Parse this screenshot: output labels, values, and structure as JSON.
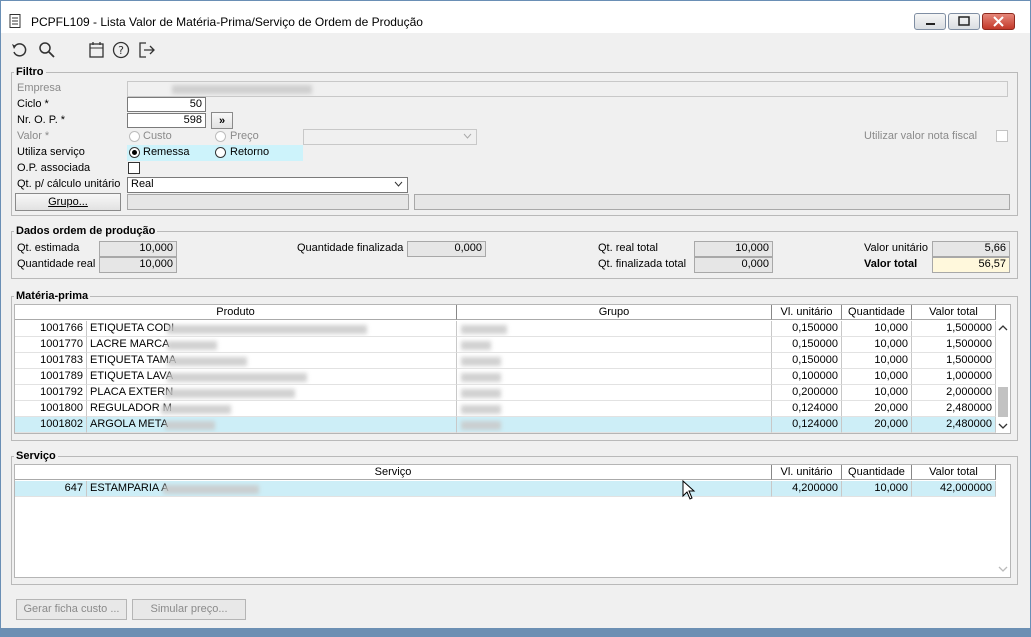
{
  "window": {
    "title": "PCPFL109 - Lista Valor de Matéria-Prima/Serviço de Ordem de Produção"
  },
  "toolbar": {
    "icons": [
      "undo-icon",
      "search-icon",
      "calendar-icon",
      "help-icon",
      "exit-icon"
    ]
  },
  "filtro": {
    "legend": "Filtro",
    "empresa_label": "Empresa",
    "ciclo_label": "Ciclo *",
    "ciclo_value": "50",
    "nr_op_label": "Nr. O. P. *",
    "nr_op_value": "598",
    "nr_op_button": "»",
    "valor_label": "Valor *",
    "custo_label": "Custo",
    "preco_label": "Preço",
    "utilizar_nf_label": "Utilizar valor nota fiscal",
    "utiliza_servico_label": "Utiliza serviço",
    "remessa_label": "Remessa",
    "retorno_label": "Retorno",
    "op_associada_label": "O.P. associada",
    "qt_calculo_label": "Qt. p/ cálculo unitário",
    "qt_calculo_value": "Real",
    "grupo_button": "Grupo..."
  },
  "dados": {
    "legend": "Dados ordem de produção",
    "qt_estimada_label": "Qt. estimada",
    "qt_estimada_value": "10,000",
    "qt_real_label": "Quantidade real",
    "qt_real_value": "10,000",
    "qt_finalizada_label": "Quantidade finalizada",
    "qt_finalizada_value": "0,000",
    "qt_real_total_label": "Qt. real total",
    "qt_real_total_value": "10,000",
    "qt_finalizada_total_label": "Qt. finalizada total",
    "qt_finalizada_total_value": "0,000",
    "valor_unitario_label": "Valor unitário",
    "valor_unitario_value": "5,66",
    "valor_total_label": "Valor total",
    "valor_total_value": "56,57"
  },
  "materia": {
    "legend": "Matéria-prima",
    "columns": [
      "Produto",
      "Grupo",
      "Vl. unitário",
      "Quantidade",
      "Valor total"
    ],
    "rows": [
      {
        "code": "1001766",
        "produto": "ETIQUETA CODI",
        "vl": "0,150000",
        "qt": "10,000",
        "total": "1,500000"
      },
      {
        "code": "1001770",
        "produto": "LACRE MARCA",
        "vl": "0,150000",
        "qt": "10,000",
        "total": "1,500000"
      },
      {
        "code": "1001783",
        "produto": "ETIQUETA TAMA",
        "vl": "0,150000",
        "qt": "10,000",
        "total": "1,500000"
      },
      {
        "code": "1001789",
        "produto": "ETIQUETA LAVA",
        "vl": "0,100000",
        "qt": "10,000",
        "total": "1,000000"
      },
      {
        "code": "1001792",
        "produto": "PLACA EXTERN",
        "vl": "0,200000",
        "qt": "10,000",
        "total": "2,000000"
      },
      {
        "code": "1001800",
        "produto": "REGULADOR M",
        "vl": "0,124000",
        "qt": "20,000",
        "total": "2,480000"
      },
      {
        "code": "1001802",
        "produto": "ARGOLA META",
        "vl": "0,124000",
        "qt": "20,000",
        "total": "2,480000"
      }
    ]
  },
  "servico": {
    "legend": "Serviço",
    "columns": [
      "Serviço",
      "Vl. unitário",
      "Quantidade",
      "Valor total"
    ],
    "rows": [
      {
        "code": "647",
        "servico": "ESTAMPARIA A",
        "vl": "4,200000",
        "qt": "10,000",
        "total": "42,000000"
      }
    ]
  },
  "footer": {
    "gerar_ficha": "Gerar ficha custo ...",
    "simular_preco": "Simular preço..."
  }
}
